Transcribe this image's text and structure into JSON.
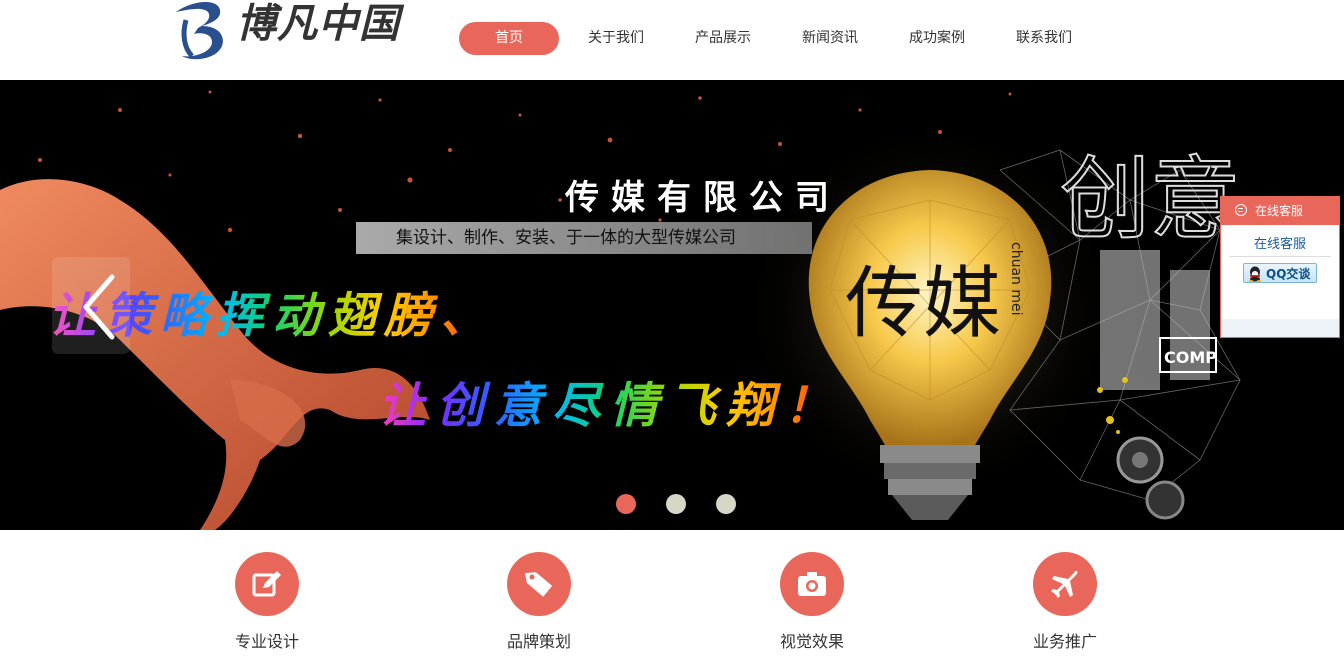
{
  "header": {
    "logo_text": "博凡中国",
    "nav": [
      {
        "label": "首页",
        "active": true
      },
      {
        "label": "关于我们",
        "active": false
      },
      {
        "label": "产品展示",
        "active": false
      },
      {
        "label": "新闻资讯",
        "active": false
      },
      {
        "label": "成功案例",
        "active": false
      },
      {
        "label": "联系我们",
        "active": false
      }
    ]
  },
  "banner": {
    "company_title": "传媒有限公司",
    "tagline": "集设计、制作、安装、于一体的大型传媒公司",
    "slogan_line1": "让策略挥动翅膀、",
    "slogan_line2": "让创意尽情飞翔！",
    "bulb_text_cn": "传媒",
    "bulb_text_pinyin": "chuan mei",
    "right_big_text": "创意",
    "right_small_text": "COMP",
    "prev_arrow_icon": "chevron-left-icon",
    "slides_total": 3,
    "active_slide": 1
  },
  "services": [
    {
      "label": "专业设计",
      "icon": "edit-icon"
    },
    {
      "label": "品牌策划",
      "icon": "tag-icon"
    },
    {
      "label": "视觉效果",
      "icon": "camera-icon"
    },
    {
      "label": "业务推广",
      "icon": "airplane-icon"
    }
  ],
  "customer_service": {
    "title": "在线客服",
    "link": "在线客服",
    "qq_button": "QQ交谈"
  },
  "colors": {
    "accent": "#e9675a",
    "text": "#333333",
    "banner_bg": "#000000"
  }
}
